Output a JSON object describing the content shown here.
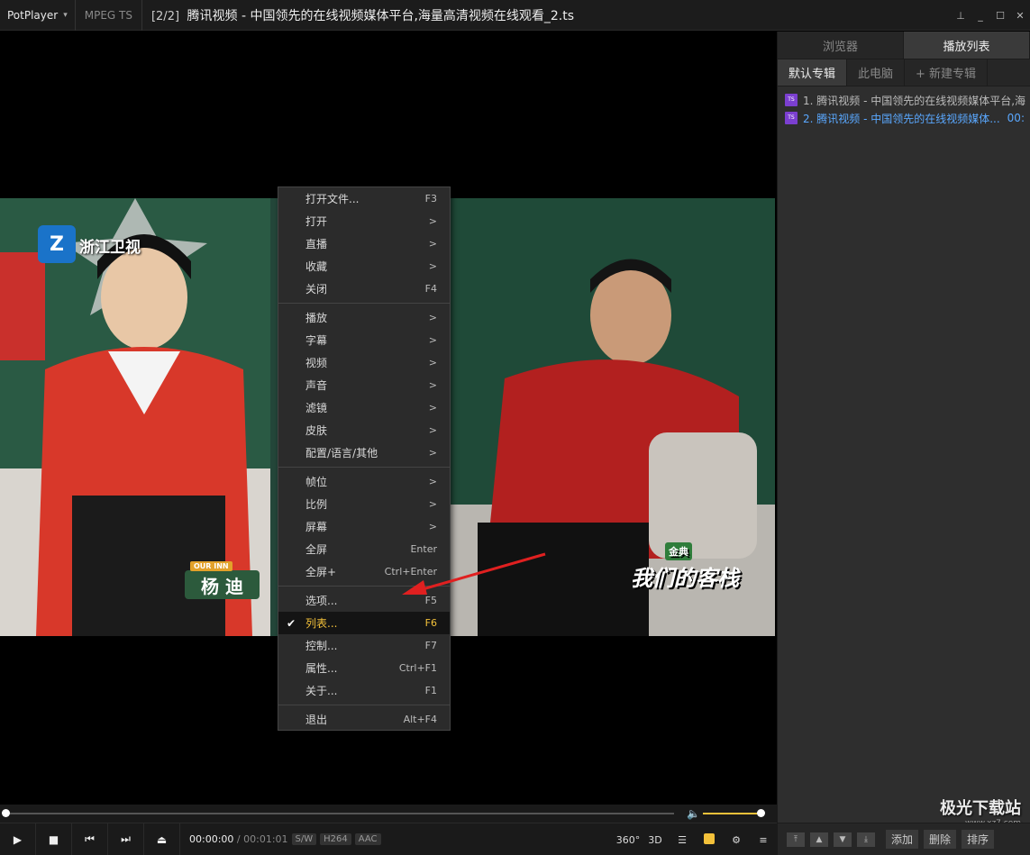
{
  "titlebar": {
    "app_name": "PotPlayer",
    "format": "MPEG TS",
    "index": "[2/2]",
    "filename": "腾讯视频 - 中国领先的在线视频媒体平台,海量高清视频在线观看_2.ts"
  },
  "video": {
    "channel_logo": "浙江卫视",
    "nameplate_tag": "OUR INN",
    "nameplate_name": "杨 迪",
    "brand_main": "我们的客栈",
    "brand_small": "金典"
  },
  "context_menu": [
    {
      "label": "打开文件...",
      "shortcut": "F3"
    },
    {
      "label": "打开",
      "shortcut": ">"
    },
    {
      "label": "直播",
      "shortcut": ">"
    },
    {
      "label": "收藏",
      "shortcut": ">"
    },
    {
      "label": "关闭",
      "shortcut": "F4"
    },
    {
      "label": "播放",
      "shortcut": ">"
    },
    {
      "label": "字幕",
      "shortcut": ">"
    },
    {
      "label": "视频",
      "shortcut": ">"
    },
    {
      "label": "声音",
      "shortcut": ">"
    },
    {
      "label": "滤镜",
      "shortcut": ">"
    },
    {
      "label": "皮肤",
      "shortcut": ">"
    },
    {
      "label": "配置/语言/其他",
      "shortcut": ">"
    },
    {
      "label": "帧位",
      "shortcut": ">"
    },
    {
      "label": "比例",
      "shortcut": ">"
    },
    {
      "label": "屏幕",
      "shortcut": ">"
    },
    {
      "label": "全屏",
      "shortcut": "Enter"
    },
    {
      "label": "全屏+",
      "shortcut": "Ctrl+Enter"
    },
    {
      "label": "选项...",
      "shortcut": "F5"
    },
    {
      "label": "列表...",
      "shortcut": "F6"
    },
    {
      "label": "控制...",
      "shortcut": "F7"
    },
    {
      "label": "属性...",
      "shortcut": "Ctrl+F1"
    },
    {
      "label": "关于...",
      "shortcut": "F1"
    },
    {
      "label": "退出",
      "shortcut": "Alt+F4"
    }
  ],
  "controls": {
    "time_current": "00:00:00",
    "time_sep": "/",
    "time_total": "00:01:01",
    "badge_sw": "S/W",
    "badge_video": "H264",
    "badge_audio": "AAC",
    "btn_360": "360°",
    "btn_3d": "3D",
    "progress_fraction": 0,
    "volume_fraction": 1
  },
  "panel": {
    "tab_browser": "浏览器",
    "tab_playlist": "播放列表",
    "subtab_default": "默认专辑",
    "subtab_pc": "此电脑",
    "subtab_new": "+ 新建专辑",
    "items": [
      {
        "text": "1. 腾讯视频 - 中国领先的在线视频媒体平台,海",
        "duration": ""
      },
      {
        "text": "2. 腾讯视频 - 中国领先的在线视频媒体...",
        "duration": "00:"
      }
    ],
    "btn_add": "添加",
    "btn_delete": "删除",
    "btn_sort": "排序",
    "watermark": "极光下载站",
    "watermark_sub": "www.xz7.com"
  },
  "colors": {
    "accent": "#f3c13a",
    "current_item": "#5aa8ff",
    "arrow": "#e02020"
  }
}
